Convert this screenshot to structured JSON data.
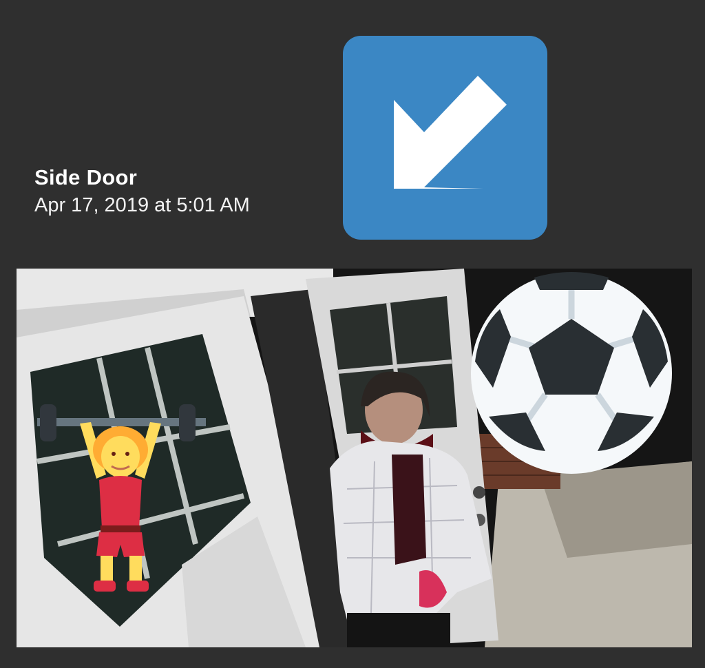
{
  "notification": {
    "camera_name": "Side Door",
    "event_time": "Apr 17, 2019 at 5:01 AM"
  },
  "icons": {
    "action_tile": "down-left-arrow-icon",
    "overlay_1": "person-lifting-weights-icon",
    "overlay_2": "soccer-ball-icon"
  },
  "colors": {
    "background": "#2f2f2f",
    "arrow_tile": "#3b87c4",
    "text": "#ffffff"
  }
}
